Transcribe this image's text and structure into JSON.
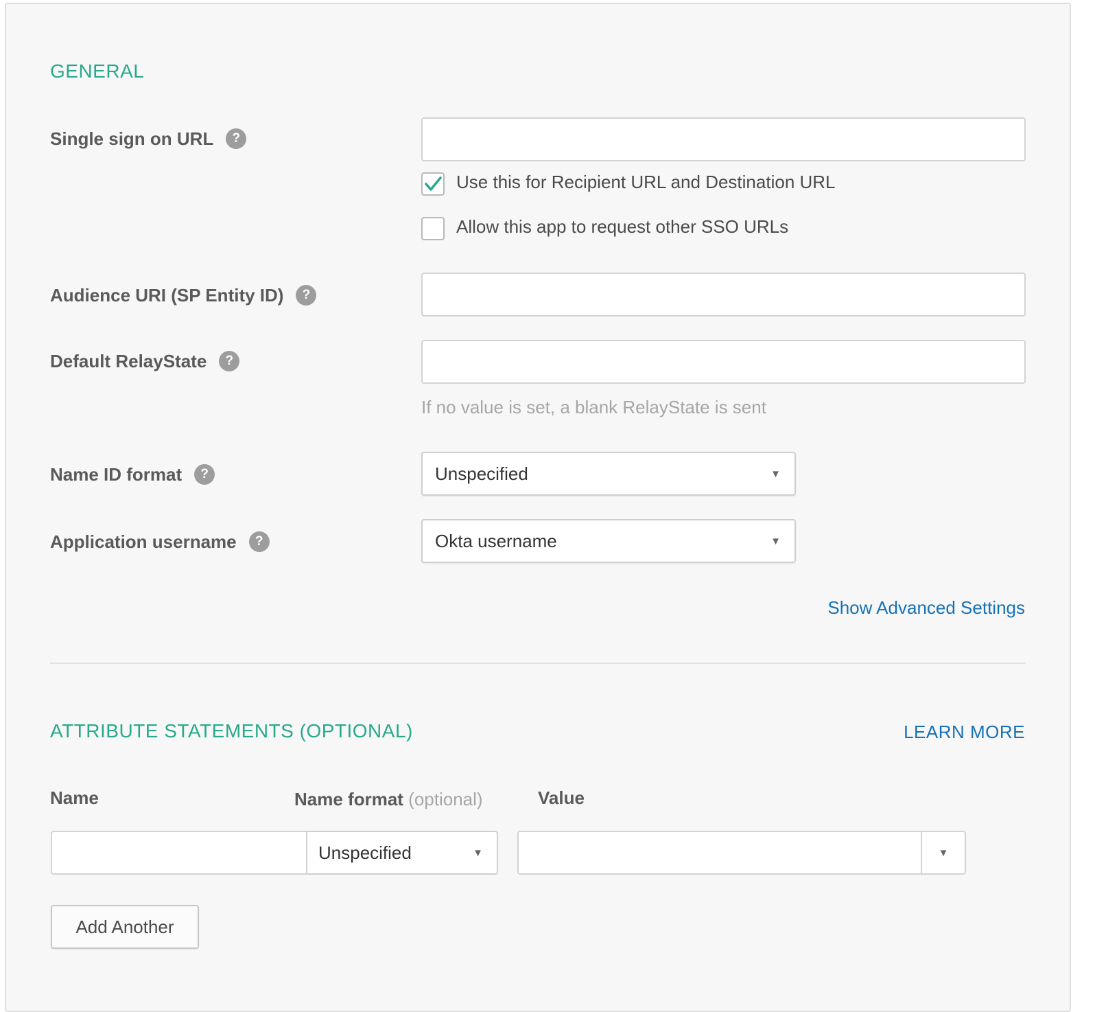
{
  "general": {
    "title": "GENERAL",
    "sso_url": {
      "label": "Single sign on URL",
      "value": ""
    },
    "use_recipient": {
      "label": "Use this for Recipient URL and Destination URL",
      "checked": true
    },
    "allow_other_sso": {
      "label": "Allow this app to request other SSO URLs",
      "checked": false
    },
    "audience_uri": {
      "label": "Audience URI (SP Entity ID)",
      "value": ""
    },
    "relay_state": {
      "label": "Default RelayState",
      "value": "",
      "hint": "If no value is set, a blank RelayState is sent"
    },
    "name_id_format": {
      "label": "Name ID format",
      "selected": "Unspecified"
    },
    "app_username": {
      "label": "Application username",
      "selected": "Okta username"
    },
    "advanced_link": "Show Advanced Settings"
  },
  "attributes": {
    "title": "ATTRIBUTE STATEMENTS (OPTIONAL)",
    "learn_more": "LEARN MORE",
    "headers": {
      "name": "Name",
      "name_format": "Name format",
      "optional": "(optional)",
      "value": "Value"
    },
    "row": {
      "name": "",
      "name_format": "Unspecified",
      "value": ""
    },
    "add_button": "Add Another"
  },
  "icons": {
    "help": "?",
    "caret": "▼",
    "check": "check-icon"
  },
  "colors": {
    "section_title": "#28a98c",
    "link": "#1672b6",
    "checkmark": "#28a98c",
    "help_icon": "#9d9d9d"
  }
}
